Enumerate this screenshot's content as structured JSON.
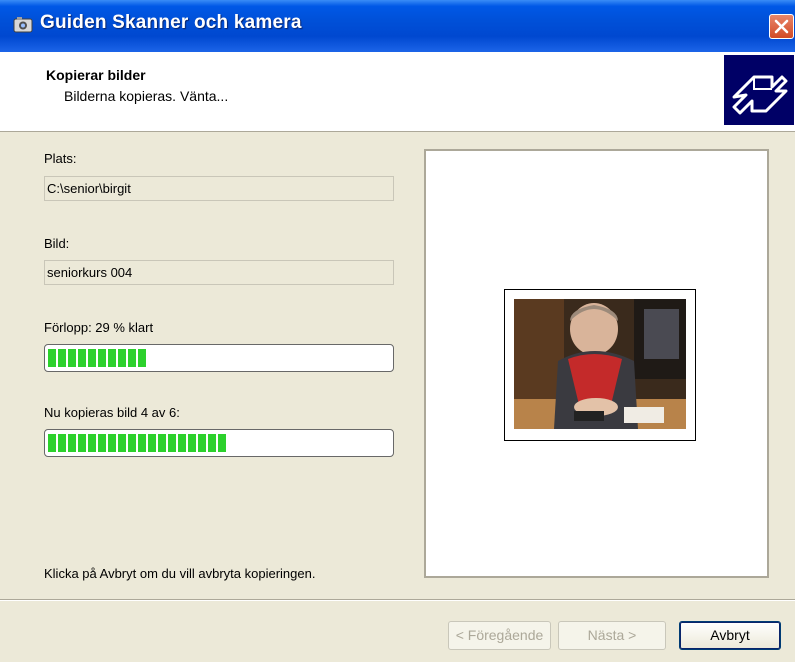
{
  "window": {
    "title": "Guiden Skanner och kamera",
    "icon": "camera-icon"
  },
  "header": {
    "title": "Kopierar bilder",
    "subtitle": "Bilderna kopieras. Vänta...",
    "icon": "wizard-icon"
  },
  "form": {
    "location_label": "Plats:",
    "location_value": "C:\\senior\\birgit",
    "picture_label": "Bild:",
    "picture_value": "seniorkurs 004",
    "progress_label": "Förlopp: 29 % klart",
    "progress_fraction": 0.29,
    "copy_label": "Nu kopieras bild 4 av 6:",
    "copy_fraction": 0.52,
    "hint": "Klicka på Avbryt om du vill avbryta kopieringen."
  },
  "buttons": {
    "back": "< Föregående",
    "next": "Nästa >",
    "cancel": "Avbryt"
  },
  "colors": {
    "titlebar": "#0054e3",
    "progress_fill": "#2cd12c",
    "wizard_icon_bg": "#000066"
  }
}
